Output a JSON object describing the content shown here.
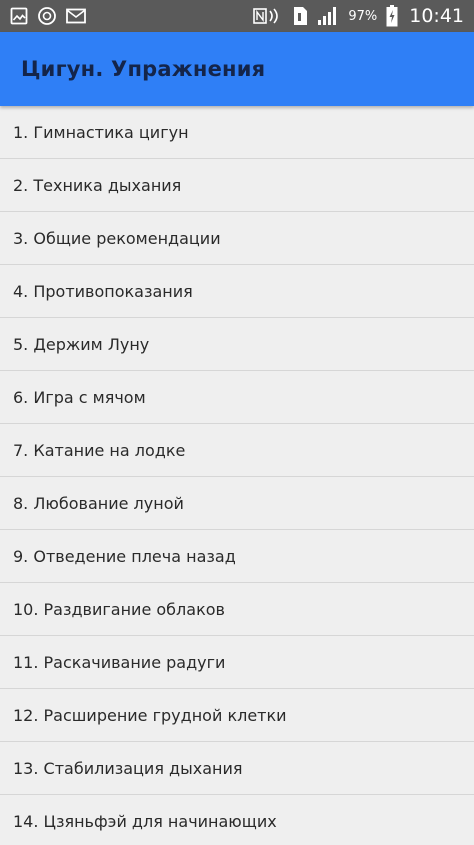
{
  "status_bar": {
    "battery_percent": "97%",
    "time": "10:41",
    "icons_left": [
      "gallery-icon",
      "sync-icon",
      "mail-icon"
    ],
    "icons_right": [
      "nfc-icon",
      "sim-icon",
      "signal-icon",
      "battery-icon"
    ]
  },
  "app_bar": {
    "title": "Цигун. Упражнения",
    "background_color": "#2f7ff6"
  },
  "list": {
    "items": [
      {
        "label": "1. Гимнастика цигун"
      },
      {
        "label": "2. Техника дыхания"
      },
      {
        "label": "3. Общие рекомендации"
      },
      {
        "label": "4. Противопоказания"
      },
      {
        "label": "5. Держим Луну"
      },
      {
        "label": "6. Игра с мячом"
      },
      {
        "label": "7. Катание на лодке"
      },
      {
        "label": "8. Любование луной"
      },
      {
        "label": "9. Отведение плеча назад"
      },
      {
        "label": "10. Раздвигание облаков"
      },
      {
        "label": "11. Раскачивание радуги"
      },
      {
        "label": "12. Расширение грудной клетки"
      },
      {
        "label": "13. Стабилизация дыхания"
      },
      {
        "label": "14. Цзяньфэй для начинающих"
      }
    ]
  }
}
